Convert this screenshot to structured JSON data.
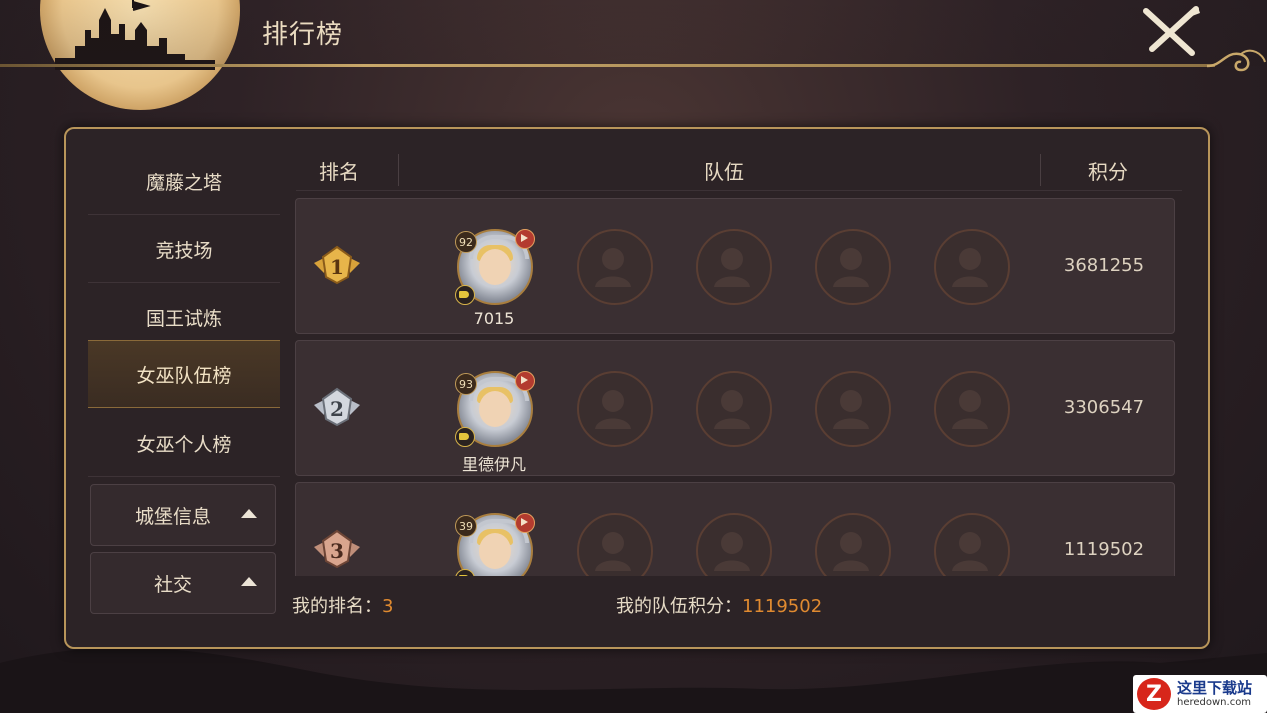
{
  "window": {
    "title": "排行榜"
  },
  "sidebar": {
    "items": [
      {
        "label": "魔藤之塔",
        "active": false
      },
      {
        "label": "竞技场",
        "active": false
      },
      {
        "label": "国王试炼",
        "active": false
      },
      {
        "label": "女巫队伍榜",
        "active": true
      },
      {
        "label": "女巫个人榜",
        "active": false
      }
    ],
    "buttons": [
      {
        "label": "城堡信息",
        "icon": "caret-up-icon"
      },
      {
        "label": "社交",
        "icon": "caret-up-icon"
      }
    ]
  },
  "table": {
    "columns": {
      "rank": "排名",
      "team": "队伍",
      "score": "积分"
    },
    "rows": [
      {
        "rank": 1,
        "rank_icon": "gold-rank-1-icon",
        "hero_level": "92",
        "hero_name": "7015",
        "score": "3681255"
      },
      {
        "rank": 2,
        "rank_icon": "silver-rank-2-icon",
        "hero_level": "93",
        "hero_name": "里德伊凡",
        "score": "3306547"
      },
      {
        "rank": 3,
        "rank_icon": "bronze-rank-3-icon",
        "hero_level": "39",
        "hero_name": "",
        "score": "1119502"
      }
    ]
  },
  "footer": {
    "my_rank_label": "我的排名：",
    "my_rank_value": "3",
    "my_score_label": "我的队伍积分：",
    "my_score_value": "1119502"
  },
  "watermark": {
    "line1": "这里下载站",
    "line2": "heredown.com"
  },
  "colors": {
    "accent_gold": "#b8955a",
    "highlight_orange": "#e08a30",
    "panel_bg": "#2c2326"
  }
}
